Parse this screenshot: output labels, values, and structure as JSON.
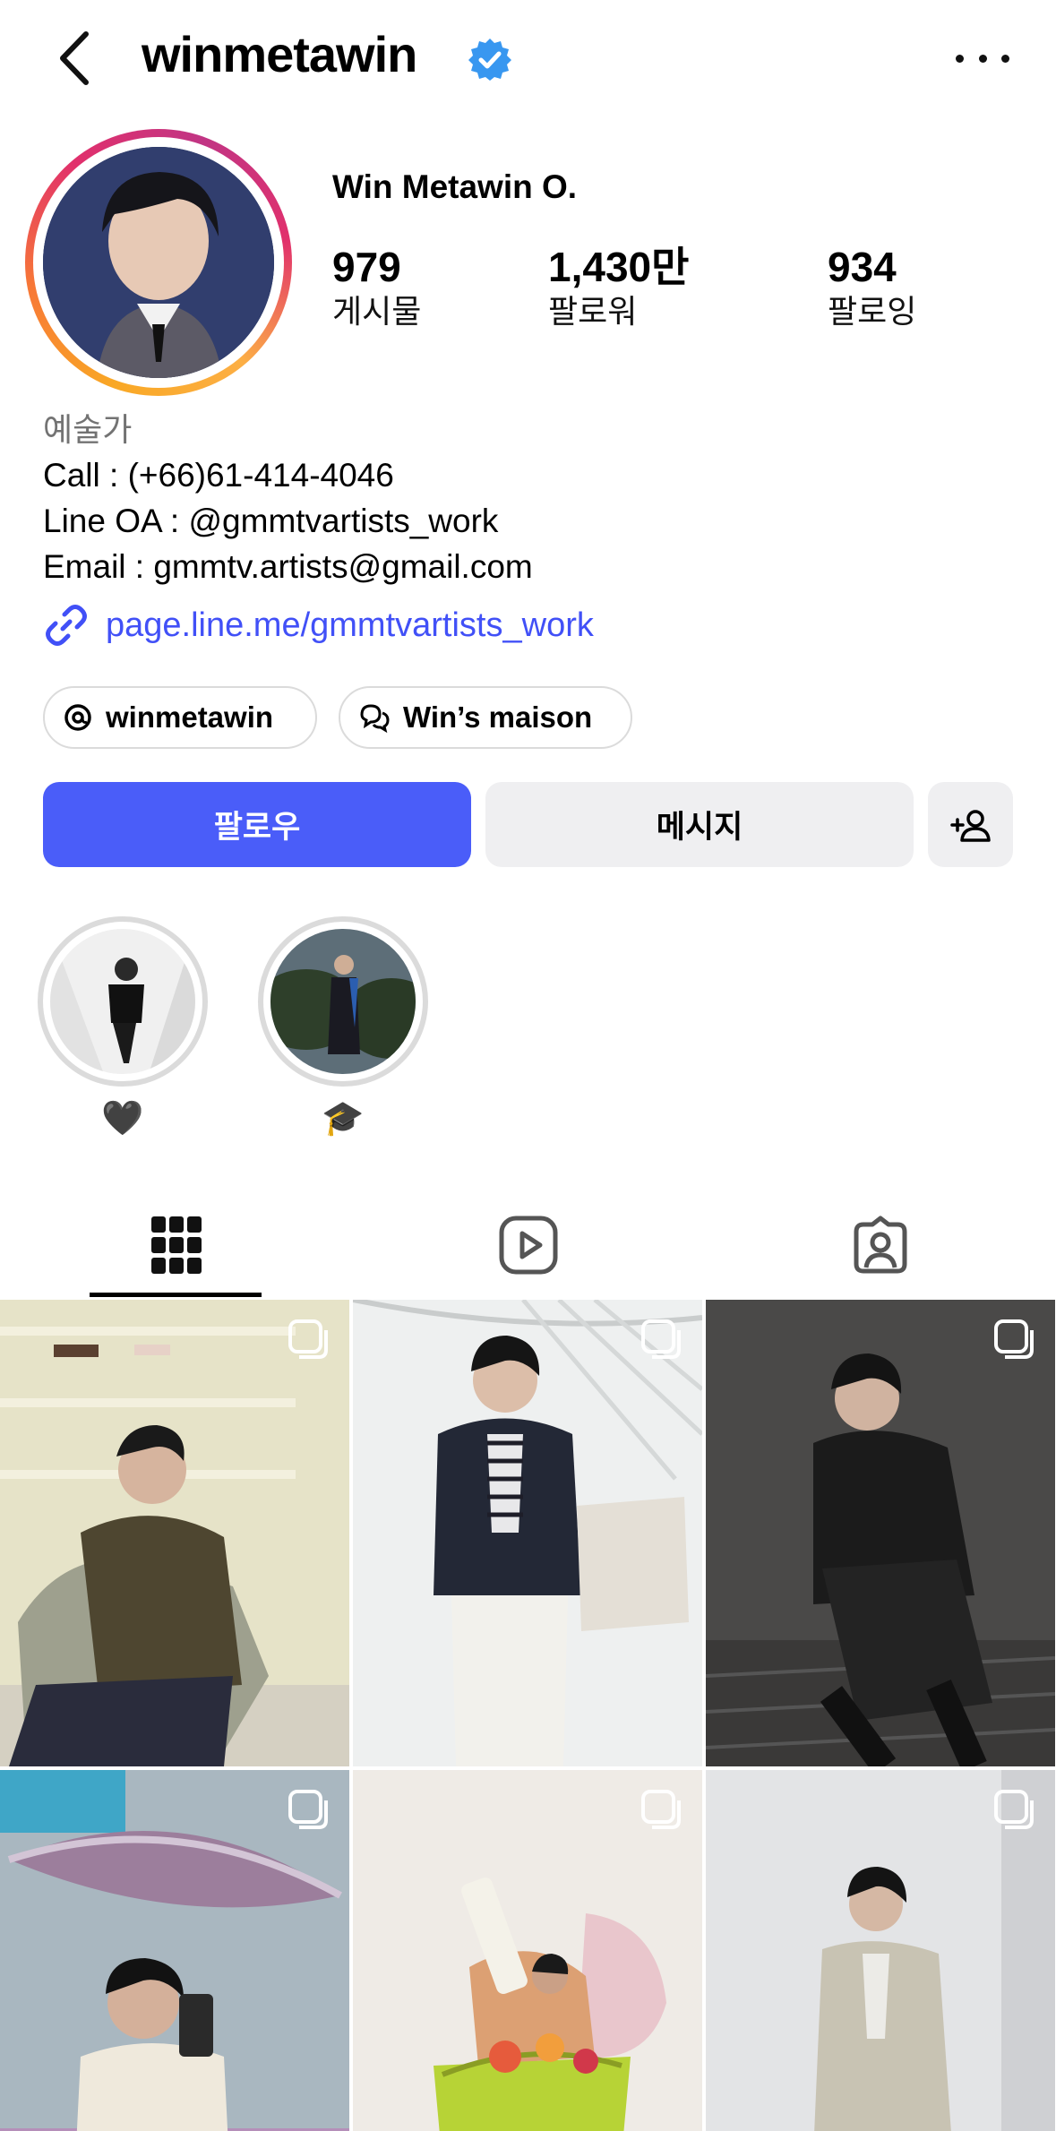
{
  "profile": {
    "username": "winmetawin",
    "display_name": "Win Metawin O.",
    "category": "예술가",
    "bio_lines": [
      "Call : (+66)61-414-4046",
      "Line OA : @gmmtvartists_work",
      "Email : gmmtv.artists@gmail.com"
    ],
    "link": "page.line.me/gmmtvartists_work"
  },
  "stats": [
    {
      "value": "979",
      "label": "게시물"
    },
    {
      "value": "1,430만",
      "label": "팔로워"
    },
    {
      "value": "934",
      "label": "팔로잉"
    }
  ],
  "chips": [
    {
      "label": "winmetawin",
      "icon": "threads-icon"
    },
    {
      "label": "Win’s maison",
      "icon": "channel-icon"
    }
  ],
  "actions": {
    "follow": "팔로우",
    "message": "메시지"
  },
  "highlights": [
    {
      "label": "🖤"
    },
    {
      "label": "🎓"
    }
  ],
  "tabs": [
    {
      "name": "grid-icon",
      "active": true
    },
    {
      "name": "reels-icon",
      "active": false
    },
    {
      "name": "tagged-icon",
      "active": false
    }
  ],
  "colors": {
    "accent": "#4a5df9",
    "link": "#4150f7",
    "verified": "#3897f0"
  }
}
